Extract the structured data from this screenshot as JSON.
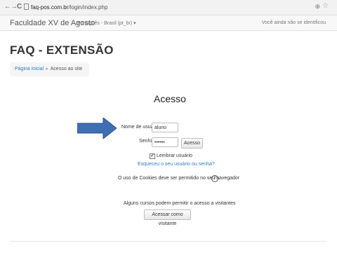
{
  "browser": {
    "back": "←",
    "forward": "→",
    "reload": "C",
    "url_domain": "faq-pos.com.br",
    "url_path": "/login/index.php",
    "zoom_icon": "⊕",
    "star_icon": "☆"
  },
  "navbar": {
    "brand": "Faculdade XV de Agosto",
    "language": "Português - Brasil (pt_br) ▾",
    "login_status": "Você ainda não se identificou"
  },
  "page": {
    "title": "FAQ - EXTENSÃO"
  },
  "breadcrumb": {
    "home": "Página inicial",
    "separator": "▸",
    "current": "Acesso ao site"
  },
  "login": {
    "heading": "Acesso",
    "username_label": "Nome de usuário",
    "username_value": "aluno",
    "password_label": "Senha",
    "password_value": "••••••",
    "submit_label": "Acesso",
    "remember_checked": "✔",
    "remember_label": "Lembrar usuário",
    "forgot_link": "Esqueceu o seu usuário ou senha?",
    "cookies_notice": "O uso de Cookies deve ser permitido no seu navegador",
    "help_icon": "?",
    "guest_notice": "Alguns cursos podem permitir o acesso a visitantes",
    "guest_button": "Acessar como visitante"
  },
  "colors": {
    "link": "#2a7bbf",
    "annotation_arrow": "#3f6fb3"
  }
}
